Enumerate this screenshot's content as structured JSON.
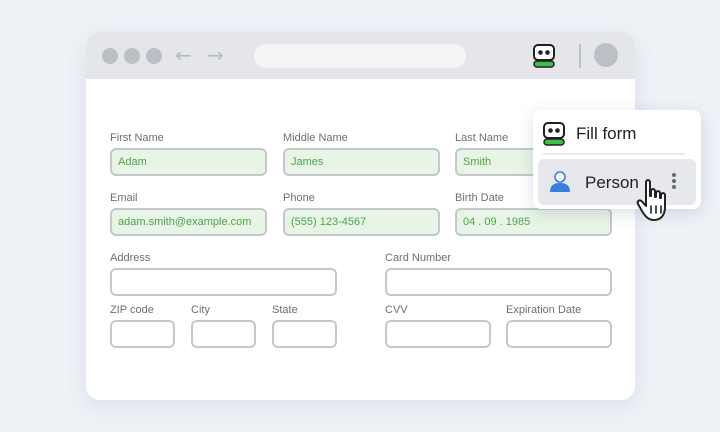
{
  "browser": {
    "back_icon": "←",
    "forward_icon": "→"
  },
  "form": {
    "first_name": {
      "label": "First Name",
      "value": "Adam"
    },
    "middle_name": {
      "label": "Middle Name",
      "value": "James"
    },
    "last_name": {
      "label": "Last Name",
      "value": "Smith"
    },
    "email": {
      "label": "Email",
      "value": "adam.smith@example.com"
    },
    "phone": {
      "label": "Phone",
      "value": "(555) 123-4567"
    },
    "birth_date": {
      "label": "Birth Date",
      "value": "04 . 09 . 1985"
    },
    "address": {
      "label": "Address",
      "value": ""
    },
    "card_number": {
      "label": "Card Number",
      "value": ""
    },
    "zip": {
      "label": "ZIP code",
      "value": ""
    },
    "city": {
      "label": "City",
      "value": ""
    },
    "state": {
      "label": "State",
      "value": ""
    },
    "cvv": {
      "label": "CVV",
      "value": ""
    },
    "expiration": {
      "label": "Expiration Date",
      "value": ""
    }
  },
  "popup": {
    "fill_form_label": "Fill form",
    "person_label": "Person"
  },
  "colors": {
    "accent_green": "#4ea348",
    "filled_bg": "#e8f5e6",
    "person_blue": "#3b7de0"
  }
}
